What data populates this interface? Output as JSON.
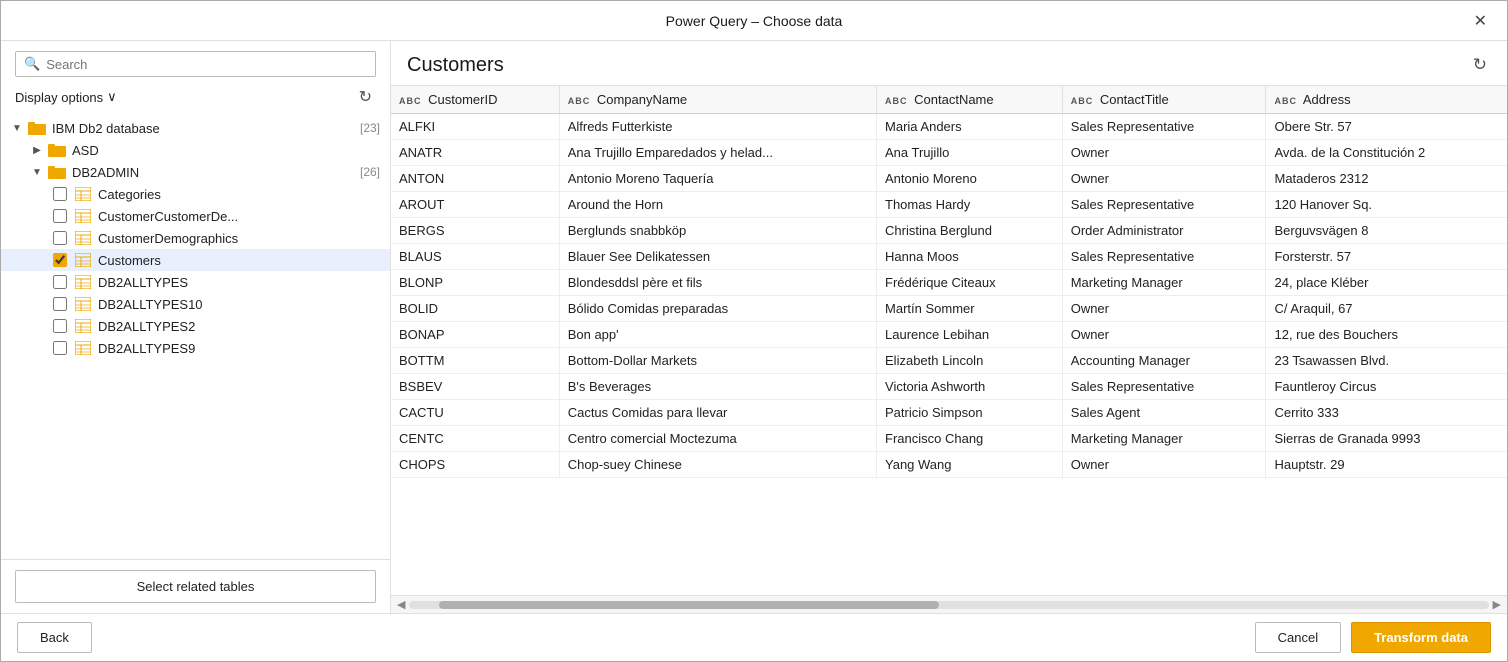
{
  "dialog": {
    "title": "Power Query – Choose data",
    "close_label": "✕"
  },
  "left_panel": {
    "search_placeholder": "Search",
    "display_options_label": "Display options",
    "display_options_arrow": "∨",
    "refresh_icon": "↻",
    "tree": [
      {
        "id": "ibm-db2",
        "type": "folder",
        "label": "IBM Db2 database",
        "count": "[23]",
        "indent": 0,
        "expanded": true,
        "checked": null
      },
      {
        "id": "asd",
        "type": "folder",
        "label": "ASD",
        "count": "",
        "indent": 1,
        "expanded": false,
        "checked": null
      },
      {
        "id": "db2admin",
        "type": "folder",
        "label": "DB2ADMIN",
        "count": "[26]",
        "indent": 1,
        "expanded": true,
        "checked": null
      },
      {
        "id": "categories",
        "type": "table",
        "label": "Categories",
        "count": "",
        "indent": 2,
        "expanded": false,
        "checked": false
      },
      {
        "id": "customercustomerde",
        "type": "table",
        "label": "CustomerCustomerDe...",
        "count": "",
        "indent": 2,
        "expanded": false,
        "checked": false
      },
      {
        "id": "customerdemographics",
        "type": "table",
        "label": "CustomerDemographics",
        "count": "",
        "indent": 2,
        "expanded": false,
        "checked": false
      },
      {
        "id": "customers",
        "type": "table",
        "label": "Customers",
        "count": "",
        "indent": 2,
        "expanded": false,
        "checked": true,
        "selected": true
      },
      {
        "id": "db2alltypes",
        "type": "table",
        "label": "DB2ALLTYPES",
        "count": "",
        "indent": 2,
        "expanded": false,
        "checked": false
      },
      {
        "id": "db2alltypes10",
        "type": "table",
        "label": "DB2ALLTYPES10",
        "count": "",
        "indent": 2,
        "expanded": false,
        "checked": false
      },
      {
        "id": "db2alltypes2",
        "type": "table",
        "label": "DB2ALLTYPES2",
        "count": "",
        "indent": 2,
        "expanded": false,
        "checked": false
      },
      {
        "id": "db2alltypes9",
        "type": "table",
        "label": "DB2ALLTYPES9",
        "count": "",
        "indent": 2,
        "expanded": false,
        "checked": false
      }
    ],
    "select_related_label": "Select related tables"
  },
  "right_panel": {
    "table_title": "Customers",
    "refresh_icon": "↻",
    "columns": [
      {
        "name": "CustomerID",
        "type": "ABC"
      },
      {
        "name": "CompanyName",
        "type": "ABC"
      },
      {
        "name": "ContactName",
        "type": "ABC"
      },
      {
        "name": "ContactTitle",
        "type": "ABC"
      },
      {
        "name": "Address",
        "type": "ABC"
      }
    ],
    "rows": [
      [
        "ALFKI",
        "Alfreds Futterkiste",
        "Maria Anders",
        "Sales Representative",
        "Obere Str. 57"
      ],
      [
        "ANATR",
        "Ana Trujillo Emparedados y helad...",
        "Ana Trujillo",
        "Owner",
        "Avda. de la Constitución 2"
      ],
      [
        "ANTON",
        "Antonio Moreno Taquería",
        "Antonio Moreno",
        "Owner",
        "Mataderos 2312"
      ],
      [
        "AROUT",
        "Around the Horn",
        "Thomas Hardy",
        "Sales Representative",
        "120 Hanover Sq."
      ],
      [
        "BERGS",
        "Berglunds snabbköp",
        "Christina Berglund",
        "Order Administrator",
        "Berguvsvägen 8"
      ],
      [
        "BLAUS",
        "Blauer See Delikatessen",
        "Hanna Moos",
        "Sales Representative",
        "Forsterstr. 57"
      ],
      [
        "BLONP",
        "Blondesddsl père et fils",
        "Frédérique Citeaux",
        "Marketing Manager",
        "24, place Kléber"
      ],
      [
        "BOLID",
        "Bólido Comidas preparadas",
        "Martín Sommer",
        "Owner",
        "C/ Araquil, 67"
      ],
      [
        "BONAP",
        "Bon app'",
        "Laurence Lebihan",
        "Owner",
        "12, rue des Bouchers"
      ],
      [
        "BOTTM",
        "Bottom-Dollar Markets",
        "Elizabeth Lincoln",
        "Accounting Manager",
        "23 Tsawassen Blvd."
      ],
      [
        "BSBEV",
        "B's Beverages",
        "Victoria Ashworth",
        "Sales Representative",
        "Fauntleroy Circus"
      ],
      [
        "CACTU",
        "Cactus Comidas para llevar",
        "Patricio Simpson",
        "Sales Agent",
        "Cerrito 333"
      ],
      [
        "CENTC",
        "Centro comercial Moctezuma",
        "Francisco Chang",
        "Marketing Manager",
        "Sierras de Granada 9993"
      ],
      [
        "CHOPS",
        "Chop-suey Chinese",
        "Yang Wang",
        "Owner",
        "Hauptstr. 29"
      ]
    ]
  },
  "bottom_bar": {
    "back_label": "Back",
    "cancel_label": "Cancel",
    "transform_label": "Transform data"
  }
}
